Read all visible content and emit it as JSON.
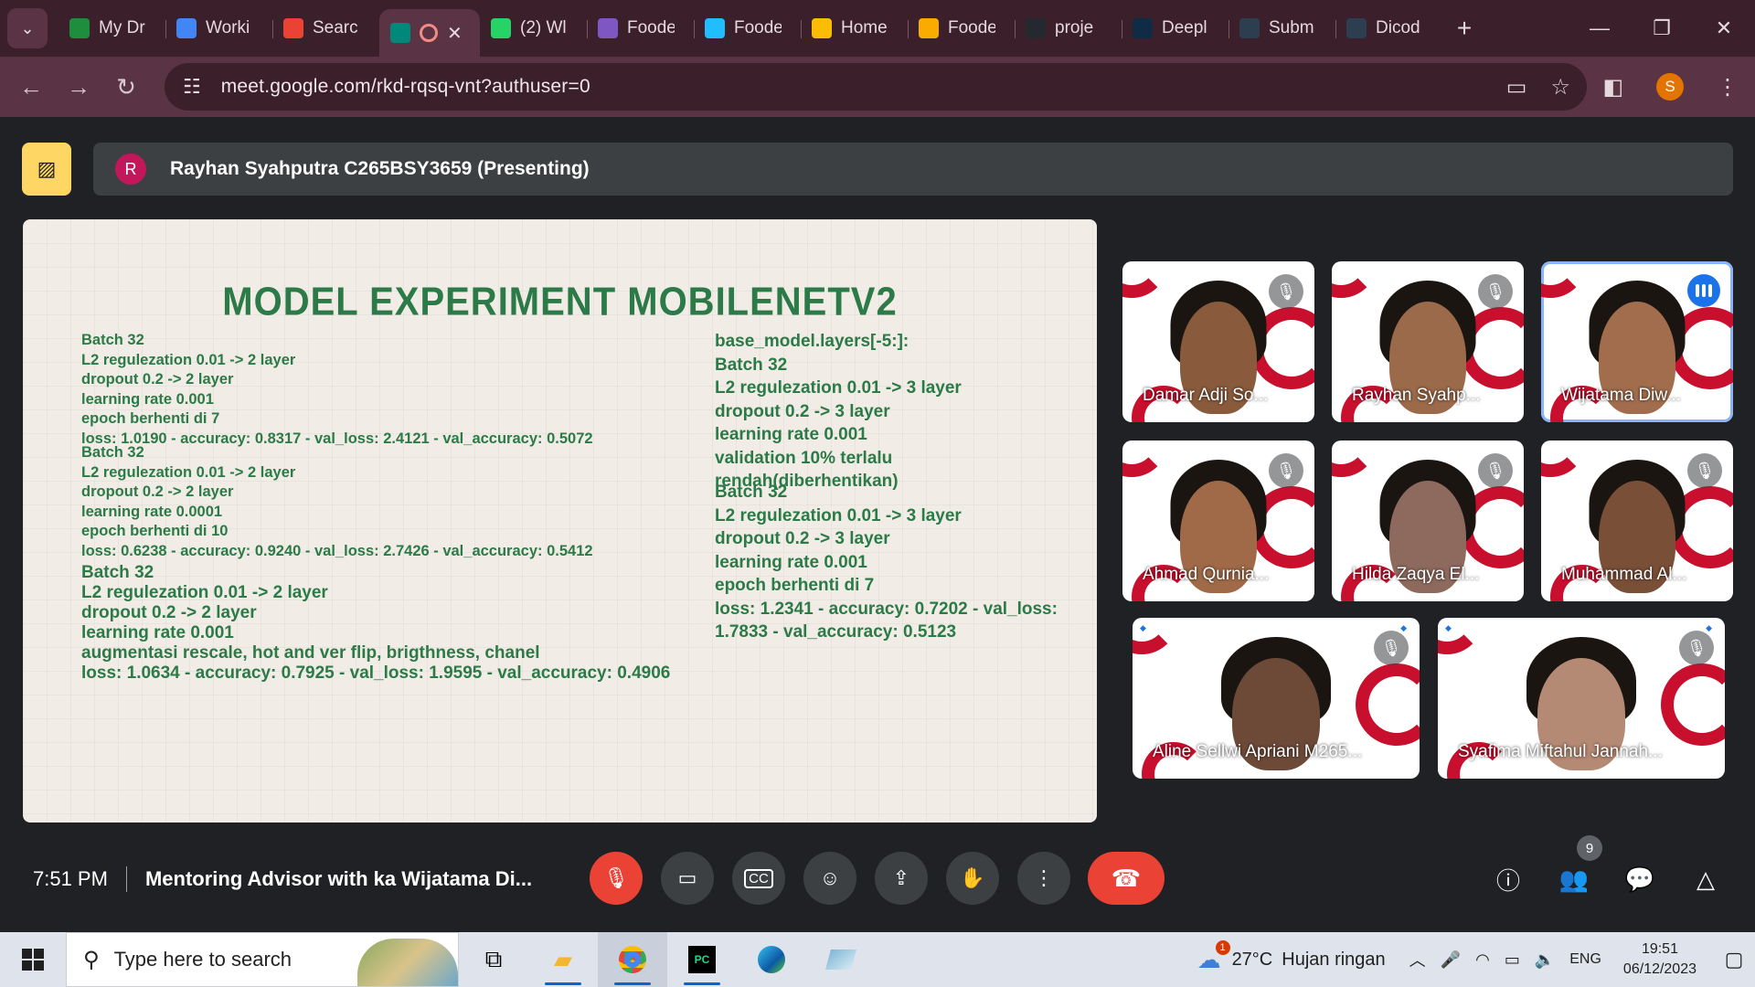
{
  "browser": {
    "tabs": [
      {
        "label": "My Dr",
        "color": "#1e8e3e",
        "icon": "google-drive-icon"
      },
      {
        "label": "Worki",
        "color": "#4285f4",
        "icon": "google-docs-icon"
      },
      {
        "label": "Searc",
        "color": "#ea4335",
        "icon": "gmail-icon"
      },
      {
        "label": "",
        "color": "#00897b",
        "icon": "google-meet-icon",
        "active": true
      },
      {
        "label": "(2) Wl",
        "color": "#25d366",
        "icon": "whatsapp-icon"
      },
      {
        "label": "Foode",
        "color": "#7e57c2",
        "icon": "app-icon"
      },
      {
        "label": "Foode",
        "color": "#20beff",
        "icon": "kaggle-icon"
      },
      {
        "label": "Home",
        "color": "#fbbc04",
        "icon": "google-drive-icon"
      },
      {
        "label": "Foode",
        "color": "#f9ab00",
        "icon": "colab-icon"
      },
      {
        "label": "proje",
        "color": "#24292f",
        "icon": "github-icon"
      },
      {
        "label": "Deepl",
        "color": "#0f2b46",
        "icon": "deepl-icon"
      },
      {
        "label": "Subm",
        "color": "#2d3e50",
        "icon": "dicoding-icon"
      },
      {
        "label": "Dicod",
        "color": "#2d3e50",
        "icon": "dicoding-icon"
      }
    ],
    "url": "meet.google.com/rkd-rqsq-vnt?authuser=0",
    "profile_initial": "S"
  },
  "meet": {
    "presenter_initial": "R",
    "presenter": "Rayhan Syahputra C265BSY3659 (Presenting)",
    "slide": {
      "title": "MODEL EXPERIMENT MOBILENETV2",
      "block1": [
        "Batch 32",
        "L2 regulezation 0.01 -> 2 layer",
        "dropout 0.2 -> 2 layer",
        "learning rate 0.001",
        "epoch berhenti di 7",
        "loss: 1.0190 - accuracy: 0.8317 - val_loss: 2.4121 - val_accuracy: 0.5072"
      ],
      "block2": [
        "Batch 32",
        "L2 regulezation 0.01 -> 2 layer",
        "dropout 0.2 -> 2 layer",
        "learning rate 0.0001",
        "epoch berhenti di 10",
        "loss: 0.6238 - accuracy: 0.9240 - val_loss: 2.7426 - val_accuracy: 0.5412"
      ],
      "block3": [
        "Batch 32",
        "L2 regulezation 0.01 -> 2 layer",
        "dropout 0.2 -> 2 layer",
        "learning rate 0.001",
        "augmentasi rescale, hot and ver flip, brigthness, chanel",
        "loss: 1.0634 - accuracy: 0.7925 - val_loss: 1.9595 - val_accuracy: 0.4906"
      ],
      "block4": [
        "base_model.layers[-5:]:",
        "Batch 32",
        "L2 regulezation 0.01 -> 3 layer",
        "dropout 0.2 -> 3 layer",
        "learning rate 0.001",
        "validation 10% terlalu",
        "rendah(diberhentikan)"
      ],
      "block5": [
        "Batch 32",
        "L2 regulezation 0.01 -> 3 layer",
        "dropout 0.2 -> 3 layer",
        "learning rate 0.001",
        "epoch berhenti di 7",
        "loss: 1.2341 - accuracy: 0.7202 - val_loss:",
        "1.7833 - val_accuracy: 0.5123"
      ]
    },
    "participants": [
      {
        "name": "Damar Adji So...",
        "muted": true
      },
      {
        "name": "Rayhan Syahp...",
        "muted": true
      },
      {
        "name": "Wijatama Diw...",
        "muted": false,
        "speaking": true
      },
      {
        "name": "Ahmad Qurnia...",
        "muted": true
      },
      {
        "name": "Hilda Zaqya El...",
        "muted": true
      },
      {
        "name": "Muhammad Al...",
        "muted": true
      },
      {
        "name": "Aline Sellwi Apriani M265...",
        "muted": true
      },
      {
        "name": "Syafima Miftahul Jannah...",
        "muted": true
      }
    ],
    "time": "7:51 PM",
    "meeting_title": "Mentoring Advisor with ka Wijatama Di...",
    "participant_count": "9"
  },
  "taskbar": {
    "search_placeholder": "Type here to search",
    "weather_badge": "1",
    "temperature": "27°C",
    "weather": "Hujan ringan",
    "language": "ENG",
    "time": "19:51",
    "date": "06/12/2023"
  }
}
